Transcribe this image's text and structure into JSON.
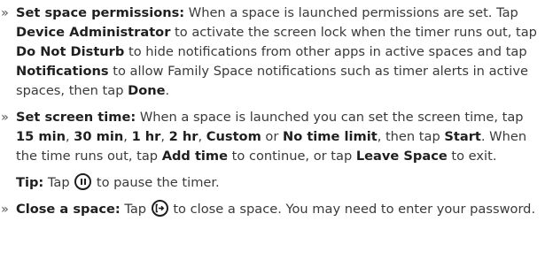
{
  "bullet_glyph": "»",
  "items": [
    {
      "label": "Set space permissions:",
      "t1": " When a space is launched permissions are set. Tap ",
      "b1": "Device Administrator",
      "t2": " to activate the screen lock when the timer runs out, tap ",
      "b2": "Do Not Disturb",
      "t3": " to hide notifications from other apps in active spaces and tap ",
      "b3": "Notifications",
      "t4": " to allow Family Space notifications such as timer alerts in active spaces, then tap ",
      "b4": "Done",
      "t5": "."
    },
    {
      "label": "Set screen time:",
      "t1": " When a space is launched you can set the screen time, tap ",
      "opt1": "15 min",
      "sep1": ", ",
      "opt2": "30 min",
      "sep2": ", ",
      "opt3": "1 hr",
      "sep3": ", ",
      "opt4": "2 hr",
      "sep4": ", ",
      "opt5": "Custom",
      "sep5": " or ",
      "opt6": "No time limit",
      "t2": ", then tap ",
      "b_start": "Start",
      "t3": ". When the time runs out, tap ",
      "b_add": "Add time",
      "t4": " to continue, or tap ",
      "b_leave": "Leave Space",
      "t5": " to exit."
    },
    {
      "label": "Close a space:",
      "t1": " Tap ",
      "icon": "exit-icon",
      "t2": " to close a space. You may need to enter your password."
    }
  ],
  "tip": {
    "label": "Tip:",
    "t1": " Tap ",
    "icon": "pause-icon",
    "t2": " to pause the timer."
  }
}
